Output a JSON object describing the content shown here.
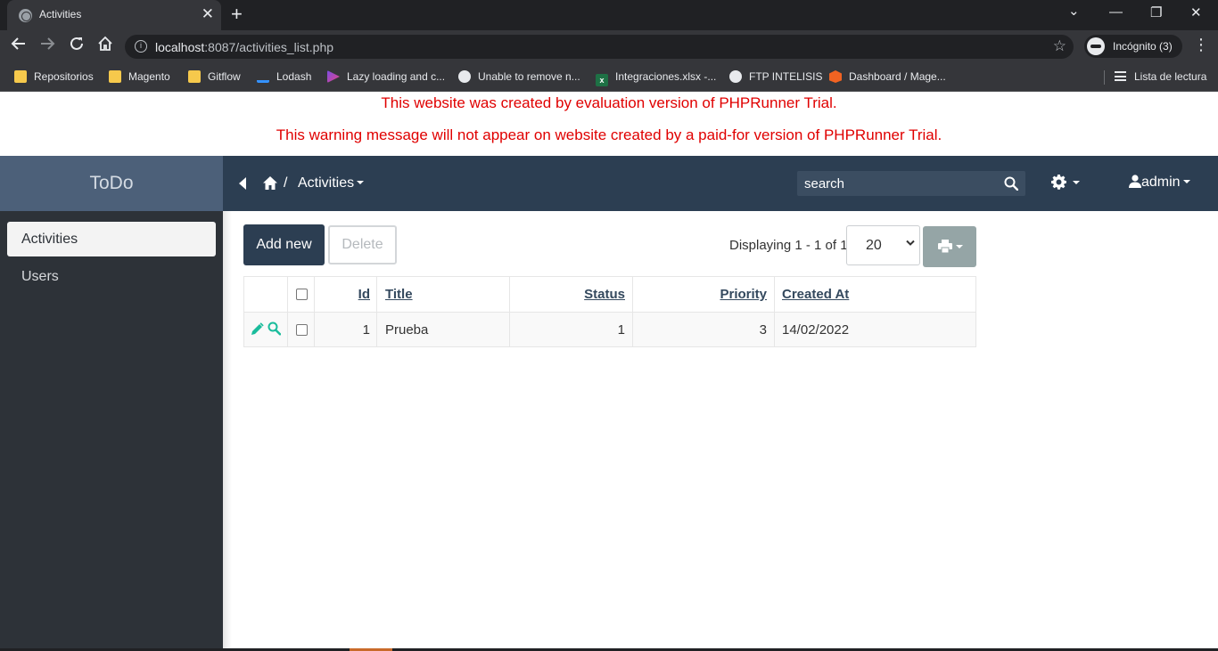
{
  "browser": {
    "tab_title": "Activities",
    "tab_close": "✕",
    "new_tab": "+",
    "controls": {
      "minimize": "—",
      "restore": "❐",
      "close": "✕",
      "menu": "⌄"
    },
    "url_host": "localhost",
    "url_rest": ":8087/activities_list.php",
    "profile_label": "Incógnito (3)",
    "bookmarks": [
      {
        "label": "Repositorios",
        "icon": "folder-icon"
      },
      {
        "label": "Magento",
        "icon": "folder-icon"
      },
      {
        "label": "Gitflow",
        "icon": "folder-icon"
      },
      {
        "label": "Lodash",
        "icon": "lodash-icon"
      },
      {
        "label": "Lazy loading and c...",
        "icon": "lazy-loading-icon"
      },
      {
        "label": "Unable to remove n...",
        "icon": "github-icon"
      },
      {
        "label": "Integraciones.xlsx -...",
        "icon": "excel-icon"
      },
      {
        "label": "FTP INTELISIS",
        "icon": "globe-icon"
      },
      {
        "label": "Dashboard / Mage...",
        "icon": "magento-icon"
      }
    ],
    "reading_list": "Lista de lectura"
  },
  "warning": {
    "line1": "This website was created by evaluation version of PHPRunner Trial.",
    "line2": "This warning message will not appear on website created by a paid-for version of PHPRunner Trial."
  },
  "sidebar": {
    "brand": "ToDo",
    "items": [
      {
        "label": "Activities",
        "active": true
      },
      {
        "label": "Users",
        "active": false
      }
    ]
  },
  "topnav": {
    "breadcrumb_sep": "/",
    "breadcrumb_current": "Activities",
    "search_placeholder": "search",
    "user_label": "admin"
  },
  "toolbar": {
    "add_label": "Add new",
    "delete_label": "Delete",
    "displaying": "Displaying 1 - 1 of 1",
    "page_size": "20"
  },
  "table": {
    "columns": [
      "Id",
      "Title",
      "Status",
      "Priority",
      "Created At"
    ],
    "rows": [
      {
        "id": "1",
        "title": "Prueba",
        "status": "1",
        "priority": "3",
        "created_at": "14/02/2022"
      }
    ]
  },
  "colors": {
    "sidebar_bg": "#2d3238",
    "brand_bg": "#4c6079",
    "topnav_bg": "#2c3e52",
    "warning_text": "#e00000",
    "action_icon": "#1abc9c"
  }
}
